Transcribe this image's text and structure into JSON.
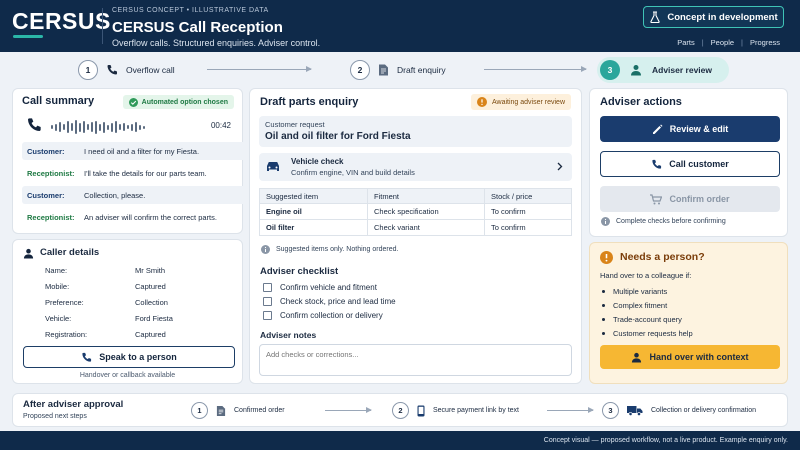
{
  "header": {
    "logo": "CERSUS",
    "kicker": "CERSUS CONCEPT • ILLUSTRATIVE DATA",
    "title": "CERSUS Call Reception",
    "subtitle": "Overflow calls. Structured enquiries. Adviser control.",
    "badge": "Concept in development",
    "nav": [
      "Parts",
      "People",
      "Progress"
    ]
  },
  "stepper": {
    "steps": [
      {
        "num": "1",
        "label": "Overflow call"
      },
      {
        "num": "2",
        "label": "Draft enquiry"
      },
      {
        "num": "3",
        "label": "Adviser review"
      }
    ]
  },
  "call_summary": {
    "title": "Call summary",
    "badge": "Automated option chosen",
    "duration": "00:42",
    "transcript": [
      {
        "speaker": "Customer:",
        "text": "I need oil and a filter for my Fiesta."
      },
      {
        "speaker": "Receptionist:",
        "text": "I'll take the details for our parts team."
      },
      {
        "speaker": "Customer:",
        "text": "Collection, please."
      },
      {
        "speaker": "Receptionist:",
        "text": "An adviser will confirm the correct parts."
      }
    ]
  },
  "caller": {
    "title": "Caller details",
    "rows": [
      {
        "label": "Name:",
        "value": "Mr Smith"
      },
      {
        "label": "Mobile:",
        "value": "Captured"
      },
      {
        "label": "Preference:",
        "value": "Collection"
      },
      {
        "label": "Vehicle:",
        "value": "Ford Fiesta"
      },
      {
        "label": "Registration:",
        "value": "Captured"
      }
    ],
    "button": "Speak to a person",
    "note": "Handover or callback available"
  },
  "draft": {
    "title": "Draft parts enquiry",
    "badge": "Awaiting adviser review",
    "request_label": "Customer request",
    "request_value": "Oil and oil filter for Ford Fiesta",
    "vehicle_title": "Vehicle check",
    "vehicle_sub": "Confirm engine, VIN and build details",
    "table_headers": [
      "Suggested item",
      "Fitment",
      "Stock / price"
    ],
    "table_rows": [
      [
        "Engine oil",
        "Check specification",
        "To confirm"
      ],
      [
        "Oil filter",
        "Check variant",
        "To confirm"
      ]
    ],
    "info": "Suggested items only. Nothing ordered.",
    "checklist_title": "Adviser checklist",
    "checklist": [
      "Confirm vehicle and fitment",
      "Check stock, price and lead time",
      "Confirm collection or delivery"
    ],
    "notes_title": "Adviser notes",
    "notes_placeholder": "Add checks or corrections..."
  },
  "actions": {
    "title": "Adviser actions",
    "review": "Review & edit",
    "call": "Call customer",
    "confirm": "Confirm order",
    "note": "Complete checks before confirming"
  },
  "needs": {
    "title": "Needs a person?",
    "intro": "Hand over to a colleague if:",
    "items": [
      "Multiple variants",
      "Complex fitment",
      "Trade-account query",
      "Customer requests help"
    ],
    "button": "Hand over with context"
  },
  "after": {
    "title": "After adviser approval",
    "subtitle": "Proposed next steps",
    "steps": [
      {
        "num": "1",
        "label": "Confirmed order"
      },
      {
        "num": "2",
        "label": "Secure payment link by text"
      },
      {
        "num": "3",
        "label": "Collection or delivery confirmation"
      }
    ]
  },
  "footer": "Concept visual — proposed workflow, not a live product. Example enquiry only.",
  "colors": {
    "navy": "#0f2a4a",
    "teal": "#2aa69b",
    "amber": "#f6b733",
    "primary": "#1a3c6e"
  }
}
